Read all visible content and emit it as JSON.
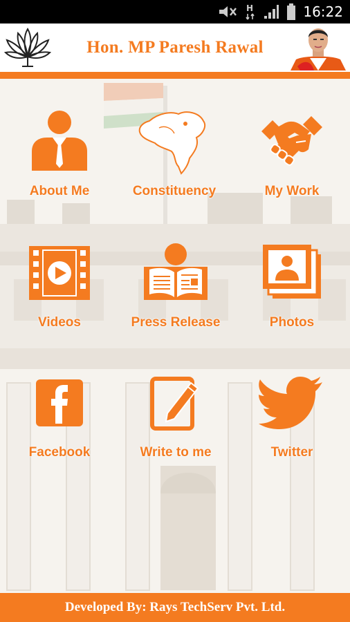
{
  "status_bar": {
    "time": "16:22"
  },
  "header": {
    "title": "Hon. MP Paresh Rawal",
    "logo_icon": "lotus-icon",
    "avatar_icon": "mp-portrait"
  },
  "menu": [
    {
      "label": "About Me",
      "icon": "person-icon"
    },
    {
      "label": "Constituency",
      "icon": "gujarat-map-icon"
    },
    {
      "label": "My Work",
      "icon": "handshake-icon"
    },
    {
      "label": "Videos",
      "icon": "video-icon"
    },
    {
      "label": "Press Release",
      "icon": "newspaper-reader-icon"
    },
    {
      "label": "Photos",
      "icon": "photos-icon"
    },
    {
      "label": "Facebook",
      "icon": "facebook-icon"
    },
    {
      "label": "Write to me",
      "icon": "write-icon"
    },
    {
      "label": "Twitter",
      "icon": "twitter-icon"
    }
  ],
  "footer": {
    "text": "Developed By: Rays TechServ Pvt. Ltd."
  },
  "colors": {
    "accent": "#f47b20",
    "status_bar": "#000000",
    "background": "#f6f3ee"
  }
}
